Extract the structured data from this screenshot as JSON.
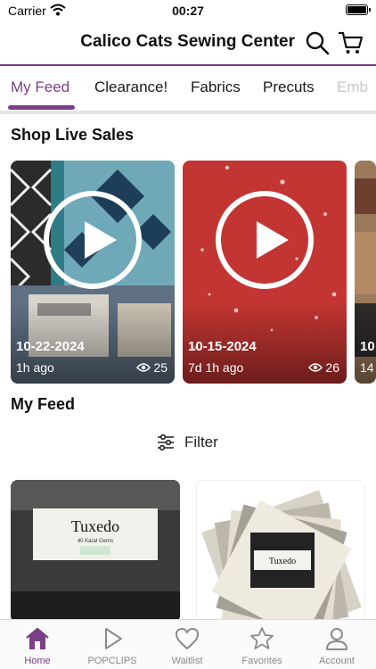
{
  "status_bar": {
    "carrier": "Carrier",
    "time": "00:27"
  },
  "header": {
    "title": "Calico Cats Sewing Center",
    "search_icon": "search-icon",
    "cart_icon": "cart-icon"
  },
  "tabs": [
    {
      "label": "My Feed",
      "active": true
    },
    {
      "label": "Clearance!"
    },
    {
      "label": "Fabrics"
    },
    {
      "label": "Precuts"
    },
    {
      "label": "Emb"
    }
  ],
  "live_sales": {
    "title": "Shop Live Sales",
    "items": [
      {
        "date": "10-22-2024",
        "ago": "1h ago",
        "views": "25"
      },
      {
        "date": "10-15-2024",
        "ago": "7d 1h ago",
        "views": "26"
      },
      {
        "date": "10",
        "ago": "14"
      }
    ]
  },
  "feed": {
    "title": "My Feed",
    "filter_label": "Filter",
    "products": [
      {
        "brand": "Tuxedo",
        "subtitle": "40 Karat Gems"
      },
      {
        "brand": "Tuxedo"
      }
    ]
  },
  "bottom_nav": [
    {
      "label": "Home",
      "icon": "home-icon",
      "active": true
    },
    {
      "label": "POPCLIPS",
      "icon": "play-icon"
    },
    {
      "label": "Waitlist",
      "icon": "heart-icon"
    },
    {
      "label": "Favorites",
      "icon": "star-icon"
    },
    {
      "label": "Account",
      "icon": "person-icon"
    }
  ],
  "colors": {
    "accent": "#7b3f87",
    "inactive": "#8a8a8a",
    "divider": "#e6e6e6"
  }
}
